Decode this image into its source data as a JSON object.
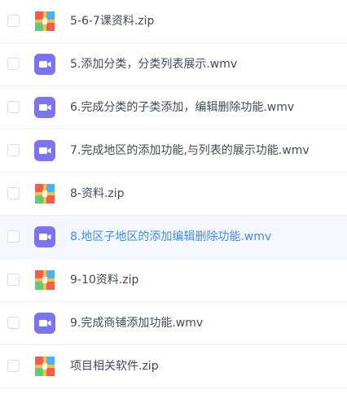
{
  "files": [
    {
      "name": "5-6-7课资料.zip",
      "icon": "zip-archive-icon",
      "type": "zip"
    },
    {
      "name": "5.添加分类，分类列表展示.wmv",
      "icon": "video-file-icon",
      "type": "video"
    },
    {
      "name": "6.完成分类的子类添加，编辑删除功能.wmv",
      "icon": "video-file-icon",
      "type": "video"
    },
    {
      "name": "7.完成地区的添加功能,与列表的展示功能.wmv",
      "icon": "video-file-icon",
      "type": "video"
    },
    {
      "name": "8-资料.zip",
      "icon": "zip-archive-icon",
      "type": "zip"
    },
    {
      "name": "8.地区子地区的添加编辑删除功能.wmv",
      "icon": "video-file-icon",
      "type": "video",
      "highlighted": true
    },
    {
      "name": "9-10资料.zip",
      "icon": "zip-archive-icon",
      "type": "zip"
    },
    {
      "name": "9.完成商铺添加功能.wmv",
      "icon": "video-file-icon",
      "type": "video"
    },
    {
      "name": "项目相关软件.zip",
      "icon": "zip-archive-icon",
      "type": "zip"
    }
  ],
  "colors": {
    "text": "#3f4a5c",
    "highlight_text": "#3b8cf5",
    "highlight_bg": "#f4f8fe",
    "video_icon": "#7b73f0",
    "zip_red": "#f25d4f",
    "zip_blue": "#4ab3f5",
    "zip_green": "#62c97a",
    "zip_yellow": "#f7c244"
  }
}
